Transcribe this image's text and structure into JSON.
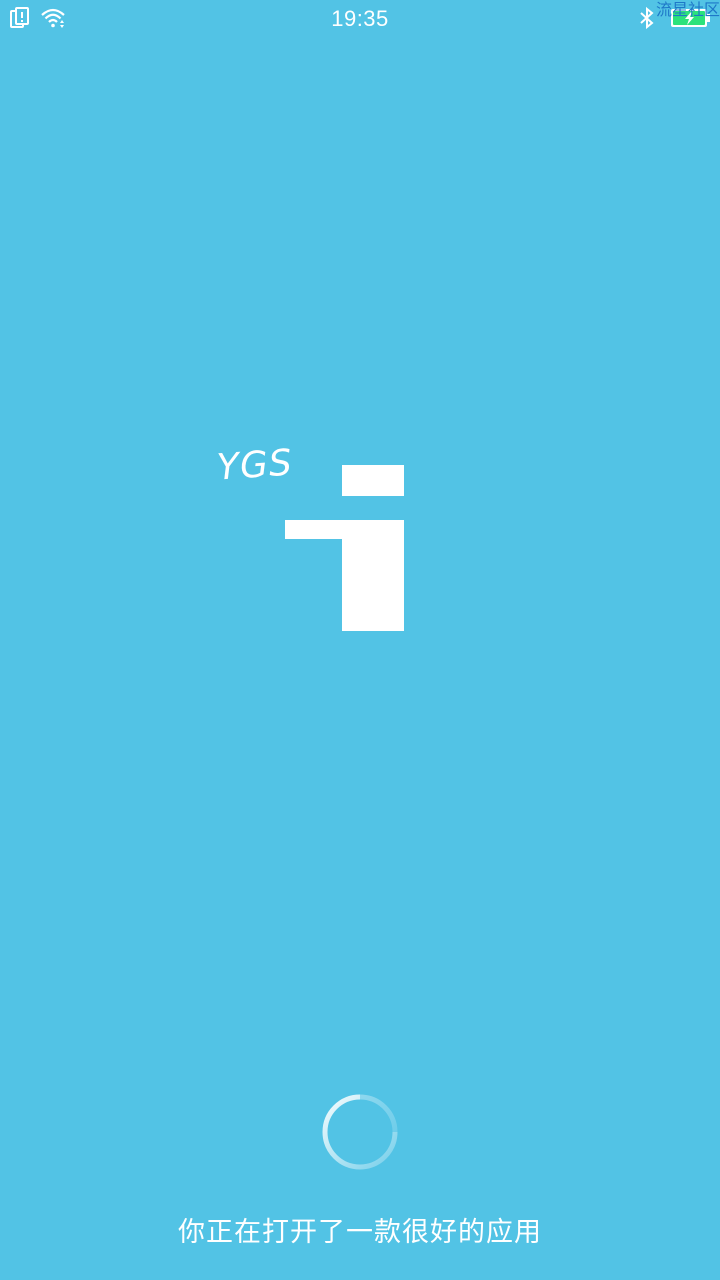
{
  "status_bar": {
    "time": "19:35",
    "icons": [
      "notification-icon",
      "wifi-icon",
      "bluetooth-icon",
      "battery-charging-icon"
    ],
    "battery_color": "#2de27b"
  },
  "watermark": "流星社区",
  "splash": {
    "logo_text": "YGS",
    "background_color": "#52c3e5",
    "caption": "你正在打开了一款很好的应用",
    "loading": true
  }
}
